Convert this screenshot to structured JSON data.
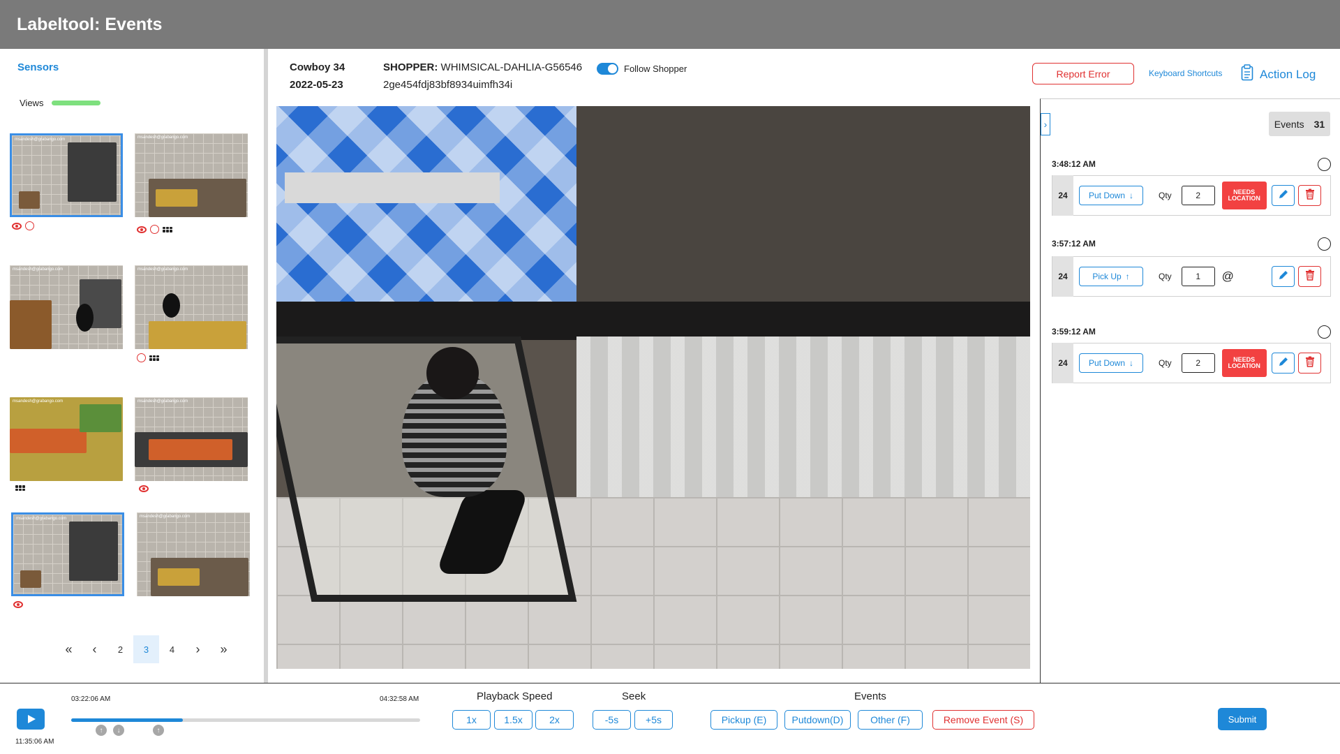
{
  "app": {
    "title": "Labeltool: Events"
  },
  "sidebar": {
    "sensors_label": "Sensors",
    "views_label": "Views",
    "thumbnails": [
      {
        "watermark": "msandesh@grabango.com",
        "selected": true,
        "icons": [
          "eye-icon",
          "circle-icon"
        ]
      },
      {
        "watermark": "msandesh@grabango.com",
        "selected": false,
        "icons": [
          "eye-icon",
          "circle-icon",
          "grid-icon"
        ]
      },
      {
        "watermark": "msandesh@grabango.com",
        "selected": false,
        "icons": []
      },
      {
        "watermark": "msandesh@grabango.com",
        "selected": false,
        "icons": [
          "circle-icon",
          "grid-icon"
        ]
      },
      {
        "watermark": "msandesh@grabango.com",
        "selected": false,
        "icons": [
          "grid-icon"
        ]
      },
      {
        "watermark": "msandesh@grabango.com",
        "selected": false,
        "icons": [
          "eye-icon"
        ]
      },
      {
        "watermark": "msandesh@grabango.com",
        "selected": true,
        "icons": [
          "eye-icon"
        ]
      },
      {
        "watermark": "msandesh@grabango.com",
        "selected": false,
        "icons": []
      }
    ],
    "pagination": {
      "first": "«",
      "prev": "‹",
      "pages": [
        "2",
        "3",
        "4"
      ],
      "active": "3",
      "next": "›",
      "last": "»"
    }
  },
  "info": {
    "store": "Cowboy 34",
    "date": "2022-05-23",
    "shopper_label": "SHOPPER:",
    "shopper_name": "WHIMSICAL-DAHLIA-G56546",
    "shopper_id": "2ge454fdj83bf8934uimfh34i",
    "follow_label": "Follow Shopper",
    "follow_on": true
  },
  "actions": {
    "report_error": "Report Error",
    "keyboard_shortcuts": "Keyboard Shortcuts",
    "action_log": "Action Log"
  },
  "events_panel": {
    "label": "Events",
    "count": "31",
    "events": [
      {
        "time": "3:48:12 AM",
        "index": "24",
        "type": "Put Down",
        "type_icon": "arrow-down-icon",
        "qty_label": "Qty",
        "qty": "2",
        "needs_location": "NEEDS LOCATION"
      },
      {
        "time": "3:57:12 AM",
        "index": "24",
        "type": "Pick Up",
        "type_icon": "arrow-up-icon",
        "qty_label": "Qty",
        "qty": "1",
        "needs_location": ""
      },
      {
        "time": "3:59:12 AM",
        "index": "24",
        "type": "Put Down",
        "type_icon": "arrow-down-icon",
        "qty_label": "Qty",
        "qty": "2",
        "needs_location": "NEEDS LOCATION"
      }
    ]
  },
  "playback": {
    "current_time": "11:35:06 AM",
    "start_time": "03:22:06 AM",
    "end_time": "04:32:58 AM",
    "progress": 0.32,
    "markers": [
      {
        "direction": "up",
        "position": 0.086
      },
      {
        "direction": "down",
        "position": 0.136
      },
      {
        "direction": "up",
        "position": 0.25
      }
    ],
    "speed_title": "Playback Speed",
    "speeds": [
      "1x",
      "1.5x",
      "2x"
    ],
    "seek_title": "Seek",
    "seeks": [
      "-5s",
      "+5s"
    ],
    "events_title": "Events",
    "event_buttons": [
      "Pickup (E)",
      "Putdown(D)",
      "Other (F)"
    ],
    "remove_event": "Remove Event (S)",
    "submit": "Submit"
  },
  "colors": {
    "accent": "#1e88d8",
    "danger": "#e03131",
    "header": "#7a7a7a",
    "views_bar": "#7ee07e"
  }
}
